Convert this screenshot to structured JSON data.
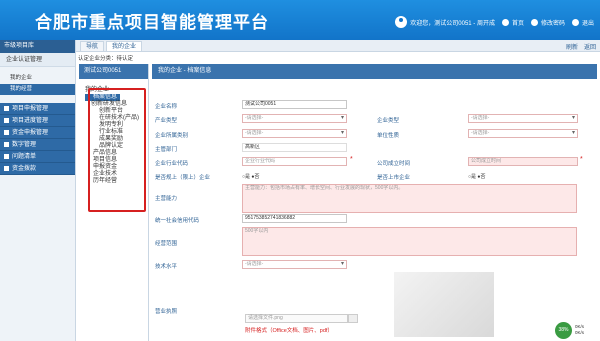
{
  "header": {
    "title": "合肥市重点项目智能管理平台",
    "welcome": "欢迎您，测试公司0051 - 周开成",
    "home": "首页",
    "change_password": "修改密码",
    "logout": "退出"
  },
  "sidebar": {
    "title": "市级项目库",
    "section": "企业认证管理",
    "sub_items": [
      "我的企业",
      "我的经营"
    ],
    "menus": [
      "项目申报管理",
      "项目进度管理",
      "资金申报管理",
      "数字管理",
      "问题清单",
      "资金拨款"
    ]
  },
  "tabs": [
    "导航",
    "我的企业"
  ],
  "tabs_right": [
    "刷新",
    "返回"
  ],
  "breadcrumb": "认定企业分类：待认定",
  "tree": {
    "header": "测试公司0051",
    "items": [
      "我的企业",
      "档案信息",
      "创新研发信息",
      "创新平台",
      "在研技术(产品)",
      "发明专利",
      "行业标准",
      "成果奖励",
      "品牌认定",
      "产品信息",
      "项目信息",
      "申报资金",
      "企业技术",
      "历年经营"
    ]
  },
  "main": {
    "header": "我的企业 - 档案信息",
    "fields": {
      "company_name_label": "企业名称",
      "company_name_value": "测试公司0051",
      "industry_type_label": "产业类型",
      "industry_type_placeholder": "-请选择-",
      "enterprise_type_label": "企业类型",
      "enterprise_type_placeholder": "-请选择-",
      "affiliation_label": "企业所属类别",
      "affiliation_placeholder": "-请选择-",
      "unit_nature_label": "单位性质",
      "unit_nature_placeholder": "-请选择-",
      "authority_label": "主管部门",
      "authority_value": "高新区",
      "industry_code_label": "企业行业代码",
      "industry_code_placeholder": "企业行业代码",
      "found_date_label": "公司成立时间",
      "found_date_placeholder": "公司成立时间",
      "above_scale_label": "是否规上（限上）企业",
      "listed_label": "是否上市企业",
      "radio_yes": "是",
      "radio_no": "否",
      "main_business_label": "主营能力",
      "main_business_placeholder": "主营能力：包括市场占有率、增长空间、行业发展的现状，500字以内。",
      "credit_code_label": "统一社会信用代码",
      "credit_code_value": "951753852741836882",
      "business_scope_label": "经营范围",
      "business_scope_placeholder": "500字以内",
      "tech_level_label": "技术水平",
      "tech_level_placeholder": "-请选择-",
      "license_label": "营业执照",
      "attach_placeholder": "请选择文件.png",
      "attach_note": "附件格式（Office文档、图片、pdf）"
    }
  },
  "status": {
    "gauge": "38%",
    "speed_up": "0K/s",
    "speed_down": "0K/s"
  }
}
